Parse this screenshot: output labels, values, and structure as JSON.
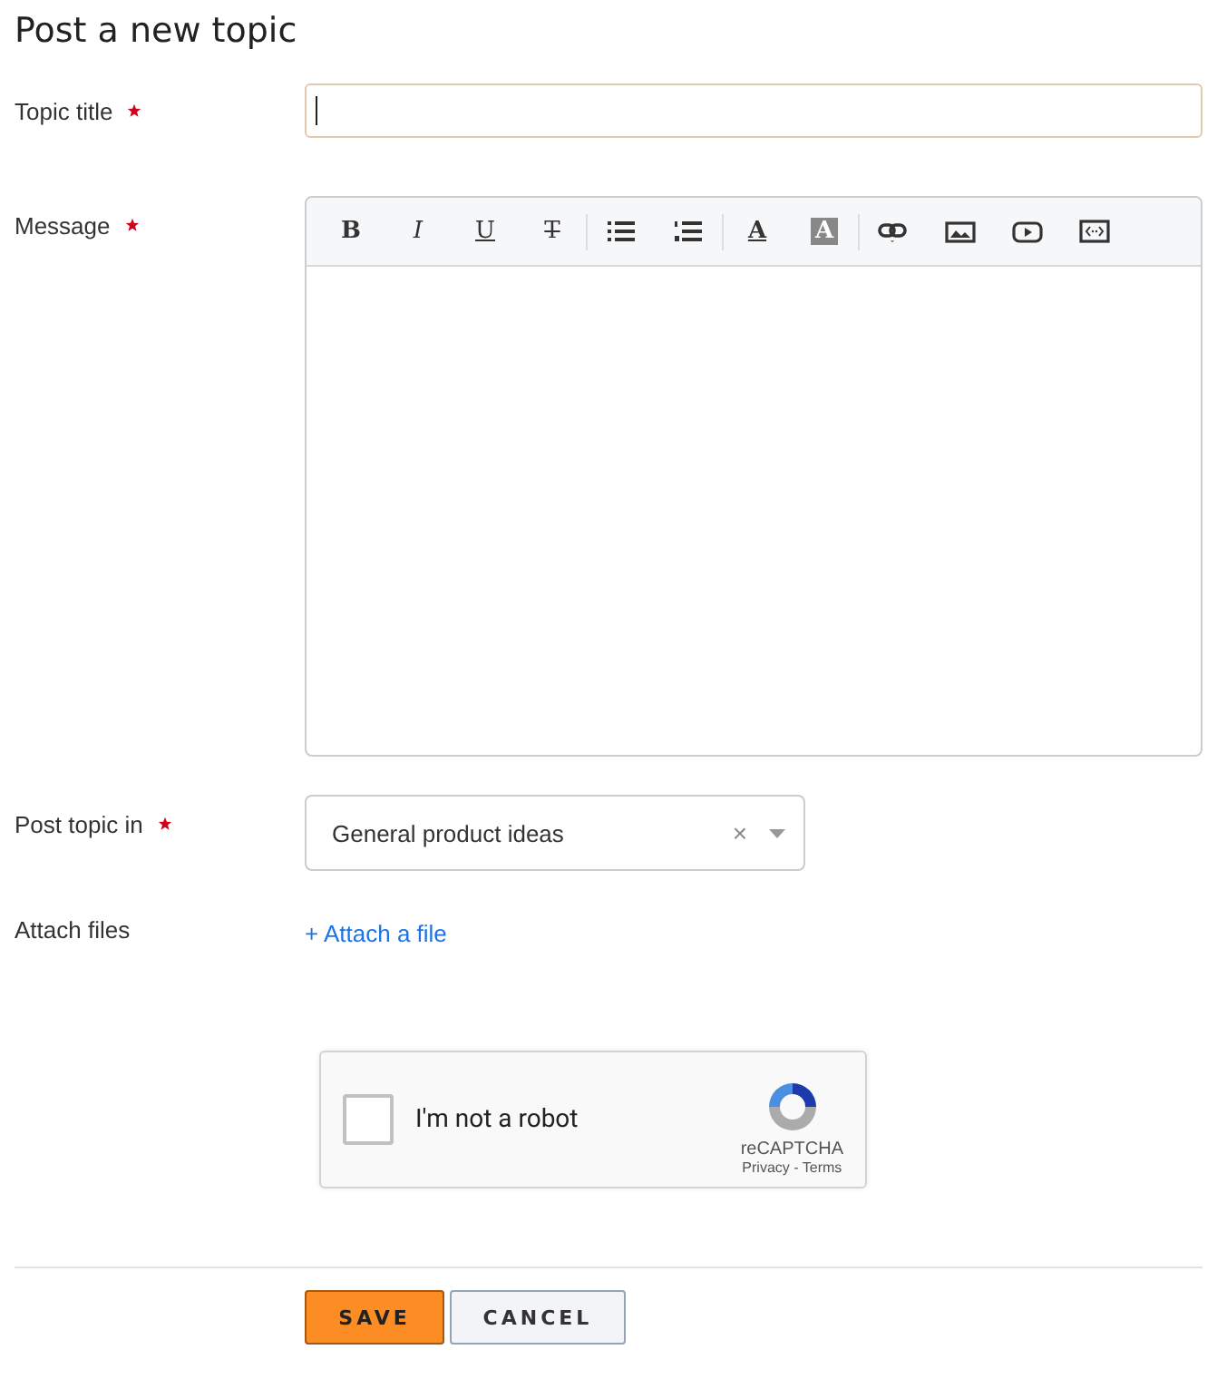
{
  "page_title": "Post a new topic",
  "fields": [
    {
      "kind": "text",
      "label": "Topic title",
      "required": true,
      "focused": true
    },
    {
      "kind": "editor",
      "label": "Message",
      "required": true,
      "toolbar": [
        [
          {
            "kind": "bold",
            "label": "B"
          },
          {
            "kind": "italic",
            "label": "I"
          },
          {
            "kind": "underline",
            "label": "U"
          },
          {
            "kind": "strike",
            "label": "T"
          }
        ],
        [
          {
            "kind": "bullets"
          },
          {
            "kind": "numbers"
          }
        ],
        [
          {
            "kind": "color",
            "label": "A"
          },
          {
            "kind": "highlight",
            "label": "A"
          }
        ],
        [
          {
            "kind": "link"
          },
          {
            "kind": "image"
          },
          {
            "kind": "video"
          },
          {
            "kind": "code"
          }
        ]
      ]
    },
    {
      "kind": "select",
      "label": "Post topic in",
      "required": true,
      "value": "General product ideas",
      "clear": "×"
    },
    {
      "kind": "attach",
      "label": "Attach files",
      "link": "+ Attach a file"
    }
  ],
  "captcha": {
    "checked": false,
    "label": "I'm not a robot",
    "brand": "reCAPTCHA",
    "links": "Privacy - Terms"
  },
  "buttons": [
    {
      "label": "SAVE",
      "kind": "primary"
    },
    {
      "label": "CANCEL",
      "kind": "secondary"
    }
  ]
}
